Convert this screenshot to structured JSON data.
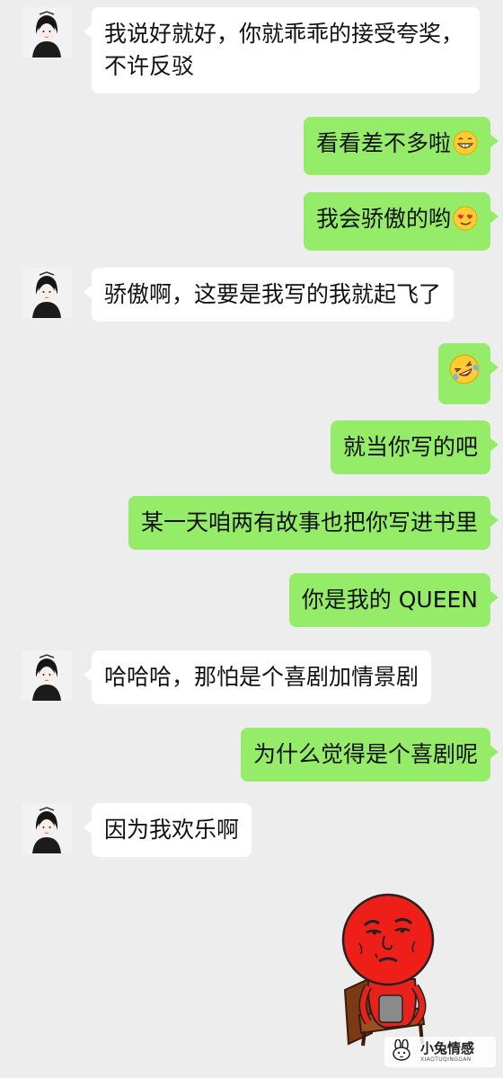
{
  "messages": [
    {
      "side": "in",
      "text": "我说好就好，你就乖乖的接受夸奖，不许反驳"
    },
    {
      "side": "out",
      "text": "看看差不多啦",
      "emoji": "grin-emoji"
    },
    {
      "side": "out",
      "text": "我会骄傲的哟",
      "emoji": "smirk-heart-eyes-emoji"
    },
    {
      "side": "in",
      "text": "骄傲啊，这要是我写的我就起飞了"
    },
    {
      "side": "out",
      "text": "",
      "emoji": "rolling-laughing-emoji"
    },
    {
      "side": "out",
      "text": "就当你写的吧"
    },
    {
      "side": "out",
      "text": "某一天咱两有故事也把你写进书里"
    },
    {
      "side": "out",
      "text": "你是我的 QUEEN"
    },
    {
      "side": "in",
      "text": "哈哈哈，那怕是个喜剧加情景剧"
    },
    {
      "side": "out",
      "text": "为什么觉得是个喜剧呢"
    },
    {
      "side": "in",
      "text": "因为我欢乐啊"
    }
  ],
  "sticker": {
    "icon": "red-face-sitting-sticker"
  },
  "watermark": {
    "title": "小兔情感",
    "subtitle": "XIAOTUQINGGAN"
  }
}
